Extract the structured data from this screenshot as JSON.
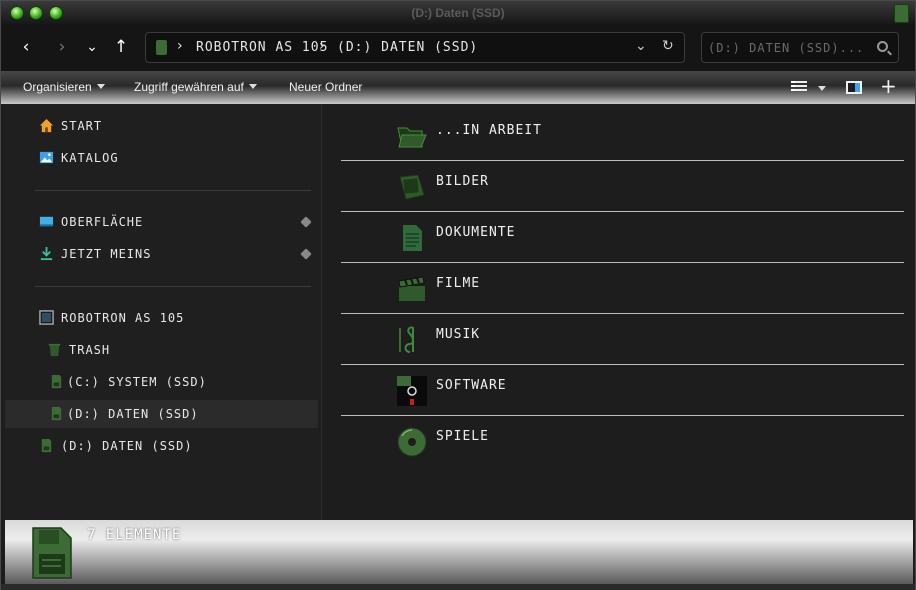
{
  "window": {
    "title": "(D:) Daten (SSD)"
  },
  "nav": {
    "back": "‹",
    "forward": "›",
    "recent": "⌄",
    "up": "↑"
  },
  "address": {
    "crumbs": [
      "ROBOTRON AS 105",
      "(D:) DATEN (SSD)"
    ],
    "separator": "›",
    "dropdown": "⌄",
    "refresh": "↻"
  },
  "search": {
    "placeholder": "(D:) DATEN (SSD)..."
  },
  "commands": {
    "organise": "Organisieren",
    "share": "Zugriff gewähren auf",
    "new_folder": "Neuer Ordner"
  },
  "sidebar": {
    "quick": [
      {
        "label": "START",
        "icon": "home-icon"
      },
      {
        "label": "KATALOG",
        "icon": "gallery-icon"
      }
    ],
    "pinned": [
      {
        "label": "OBERFLÄCHE",
        "icon": "desktop-icon"
      },
      {
        "label": "JETZT MEINS",
        "icon": "download-icon"
      }
    ],
    "tree": [
      {
        "label": "ROBOTRON AS 105",
        "icon": "computer-icon"
      },
      {
        "label": "TRASH",
        "icon": "trash-icon"
      },
      {
        "label": "(C:) SYSTEM (SSD)",
        "icon": "drive-icon"
      },
      {
        "label": "(D:) DATEN (SSD)",
        "icon": "drive-icon",
        "selected": true
      },
      {
        "label": "(D:) DATEN (SSD)",
        "icon": "drive-icon"
      }
    ]
  },
  "items": [
    {
      "name": "...IN ARBEIT",
      "icon": "open-folder-icon"
    },
    {
      "name": "BILDER",
      "icon": "pictures-icon"
    },
    {
      "name": "DOKUMENTE",
      "icon": "documents-icon"
    },
    {
      "name": "FILME",
      "icon": "clapperboard-icon"
    },
    {
      "name": "MUSIK",
      "icon": "music-icon"
    },
    {
      "name": "SOFTWARE",
      "icon": "floppy-icon"
    },
    {
      "name": "SPIELE",
      "icon": "disc-icon"
    }
  ],
  "status": {
    "count": "7 ELEMENTE"
  },
  "colors": {
    "accent": "#3c6b35",
    "background": "#1d1d1d"
  }
}
